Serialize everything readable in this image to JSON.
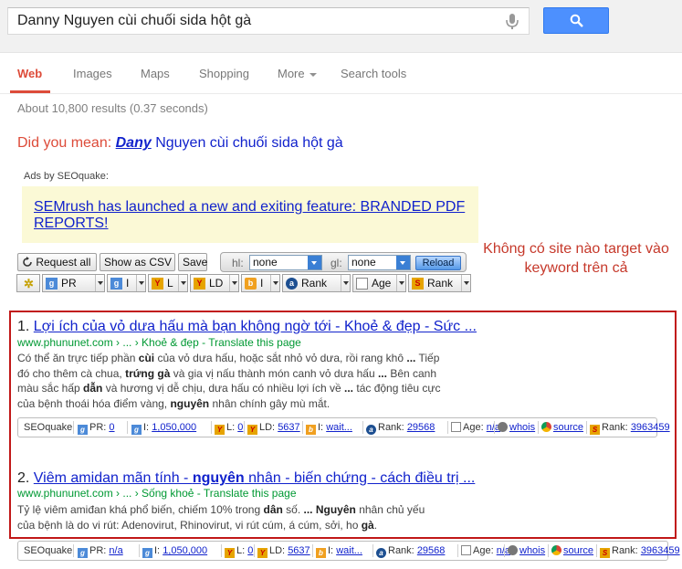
{
  "search": {
    "query": "Danny Nguyen cùi chuối sida hột gà"
  },
  "tabs": [
    {
      "label": "Web"
    },
    {
      "label": "Images"
    },
    {
      "label": "Maps"
    },
    {
      "label": "Shopping"
    },
    {
      "label": "More"
    },
    {
      "label": "Search tools"
    }
  ],
  "stats": "About 10,800 results (0.37 seconds)",
  "did_you_mean": {
    "prefix": "Did you mean:",
    "corrected": "Dany",
    "rest": "Nguyen cùi chuối sida hột gà"
  },
  "ads": {
    "label": "Ads by SEOquake:",
    "link": "SEMrush has launched a new and exiting feature: BRANDED PDF REPORTS!"
  },
  "toolbar": {
    "request_all": "Request all",
    "show_csv": "Show as CSV",
    "save": "Save",
    "hl_label": "hl:",
    "hl_value": "none",
    "gl_label": "gl:",
    "gl_value": "none",
    "reload": "Reload"
  },
  "params": [
    {
      "label": "PR"
    },
    {
      "label": "I"
    },
    {
      "label": "L"
    },
    {
      "label": "LD"
    },
    {
      "label": "I"
    },
    {
      "label": "Rank"
    },
    {
      "label": "Age"
    },
    {
      "label": "Rank"
    }
  ],
  "annotation": "Không có site nào target vào keyword trên cả",
  "results": [
    {
      "num": "1.",
      "title": "Lợi ích của vỏ dưa hấu mà bạn không ngờ tới - Khoẻ & đẹp - Sức ...",
      "url": "www.phununet.com › ... › Khoẻ & đẹp",
      "translate": "Translate this page",
      "snippet": [
        "Có thể ăn trực tiếp phần cùi của vỏ dưa hấu, hoặc sắt nhỏ vỏ dưa, rồi rang khô ... Tiếp",
        "đó cho thêm cà chua, trứng gà và gia vị nấu thành món canh vỏ dưa hấu ... Bên canh",
        "màu sắc hấp dẫn và hương vị dễ chịu, dưa hấu có nhiều lợi ích về ... tác động tiêu cực",
        "của bệnh thoái hóa điểm vàng, nguyên nhân chính gây mù mắt."
      ],
      "sq": {
        "pr": "0",
        "i": "1,050,000",
        "l": "0",
        "ld": "5637",
        "i2": "wait...",
        "rank": "29568",
        "age": "n/a",
        "whois": "whois",
        "source": "source",
        "rank2": "3963459"
      }
    },
    {
      "num": "2.",
      "title_pre": "Viêm amidan mãn tính - ",
      "title_bold": "nguyên",
      "title_post": " nhân - biến chứng - cách điều trị ...",
      "url": "www.phununet.com › ... › Sống khoẻ",
      "translate": "Translate this page",
      "snippet": [
        "Tỷ lệ viêm amiđan khá phổ biến, chiếm 10% trong dân số. ... Nguyên nhân chủ yếu",
        "của bệnh là do vi rút: Adenovirut, Rhinovirut, vi rút cúm, á cúm, sởi, ho gà."
      ],
      "sq": {
        "pr": "n/a",
        "i": "1,050,000",
        "l": "0",
        "ld": "5637",
        "i2": "wait...",
        "rank": "29568",
        "age": "n/a",
        "whois": "whois",
        "source": "source",
        "rank2": "3963459"
      }
    }
  ],
  "sq_label": "SEOquake",
  "sq_labels": {
    "pr": "PR:",
    "i": "I:",
    "l": "L:",
    "ld": "LD:",
    "i2": "I:",
    "rank": "Rank:",
    "age": "Age:",
    "rank2": "Rank:"
  },
  "colors": {
    "accent": "#dd4b39",
    "link": "#1122cc",
    "url_green": "#009933",
    "button_blue": "#4d90fe",
    "annotation_red": "#c6392b"
  }
}
